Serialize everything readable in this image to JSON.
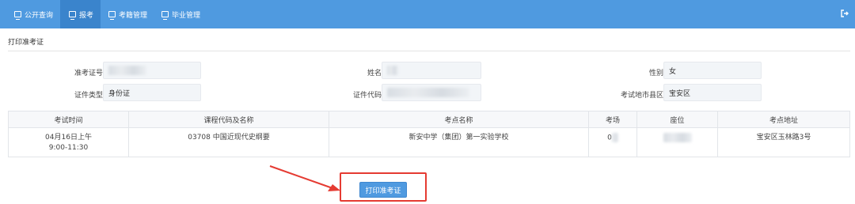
{
  "nav": {
    "items": [
      {
        "label": "公开查询",
        "active": false
      },
      {
        "label": "报考",
        "active": true
      },
      {
        "label": "考籍管理",
        "active": false
      },
      {
        "label": "毕业管理",
        "active": false
      }
    ],
    "accent_color": "#4f9ae0",
    "logout_icon": "logout-icon"
  },
  "section": {
    "title": "打印准考证"
  },
  "form": {
    "admission_no_label": "准考证号",
    "name_label": "姓名",
    "gender_label": "性别",
    "gender_value": "女",
    "id_type_label": "证件类型",
    "id_type_value": "身份证",
    "id_no_label": "证件代码",
    "district_label": "考试地市县区",
    "district_value": "宝安区"
  },
  "table": {
    "headers": [
      "考试时间",
      "课程代码及名称",
      "考点名称",
      "考场",
      "座位",
      "考点地址"
    ],
    "rows": [
      {
        "time_line1": "04月16日上午",
        "time_line2": "9:00-11:30",
        "course": "03708 中国近现代史纲要",
        "site": "新安中学（集团）第一实验学校",
        "room": "0",
        "seat": "",
        "address": "宝安区玉林路3号"
      }
    ]
  },
  "actions": {
    "print_label": "打印准考证"
  },
  "annotation_color": "#e53b32"
}
